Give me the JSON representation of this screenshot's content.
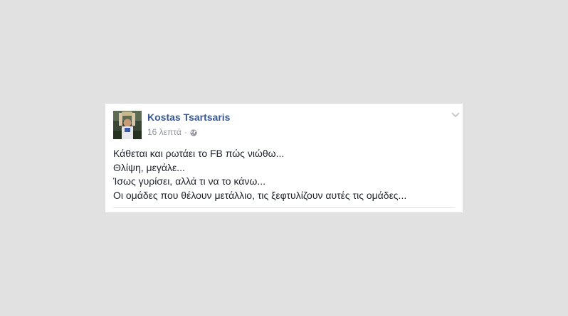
{
  "post": {
    "author": "Kostas Tsartsaris",
    "timestamp": "16 λεπτά",
    "separator": "·",
    "privacy_icon": "globe-icon",
    "menu_icon": "chevron-down-icon",
    "lines": [
      "Κάθεται και ρωτάει το FB πώς νιώθω...",
      "Θλίψη, μεγάλε...",
      "Ίσως γυρίσει, αλλά τι να το κάνω...",
      "Οι ομάδες που θέλουν μετάλλιο, τις ξεφτυλίζουν αυτές τις ομάδες..."
    ]
  },
  "colors": {
    "page_background": "#e1e1e1",
    "card_background": "#ffffff",
    "author_link": "#365899",
    "meta_text": "#90949c",
    "body_text": "#1d2129"
  }
}
